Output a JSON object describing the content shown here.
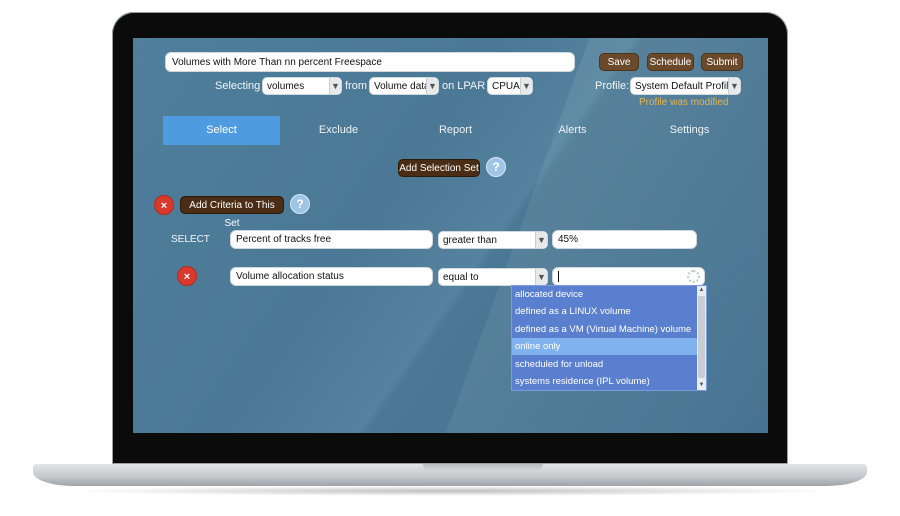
{
  "query": {
    "title_value": "Volumes with More Than nn percent Freespace",
    "selecting_label": "Selecting",
    "selecting_value": "volumes",
    "from_label": "from",
    "from_value": "Volume data",
    "lpar_label": "on LPAR",
    "lpar_value": "CPUA"
  },
  "actions": {
    "save": "Save",
    "schedule": "Schedule",
    "submit": "Submit"
  },
  "profile": {
    "label": "Profile:",
    "value": "System Default Profile",
    "status": "Profile was modified"
  },
  "tabs": [
    {
      "label": "Select",
      "active": true
    },
    {
      "label": "Exclude",
      "active": false
    },
    {
      "label": "Report",
      "active": false
    },
    {
      "label": "Alerts",
      "active": false
    },
    {
      "label": "Settings",
      "active": false
    }
  ],
  "selection": {
    "add_set_label": "Add Selection Set",
    "add_criteria_label": "Add Criteria to This Set",
    "help_glyph": "?",
    "remove_glyph": "×",
    "select_keyword": "SELECT"
  },
  "criteria": [
    {
      "field": "Percent of tracks free",
      "operator": "greater than",
      "value": "45%"
    },
    {
      "field": "Volume allocation status",
      "operator": "equal to",
      "value": ""
    }
  ],
  "value_options": [
    "allocated device",
    "defined as a LINUX volume",
    "defined as a VM (Virtual Machine) volume",
    "online only",
    "scheduled for unload",
    "systems residence (IPL volume)"
  ],
  "highlighted_option": "online only",
  "colors": {
    "background": "#4a7895",
    "accent_tab": "#4f9be0",
    "brown_button": "#6b4a2c",
    "remove": "#d8392b",
    "modified_text": "#e8b44a",
    "dropdown": "#5b7fcf"
  },
  "icons": {
    "remove": "close-icon",
    "help": "help-icon",
    "dropdown": "chevron-down-icon",
    "value_settings": "gear-icon"
  }
}
